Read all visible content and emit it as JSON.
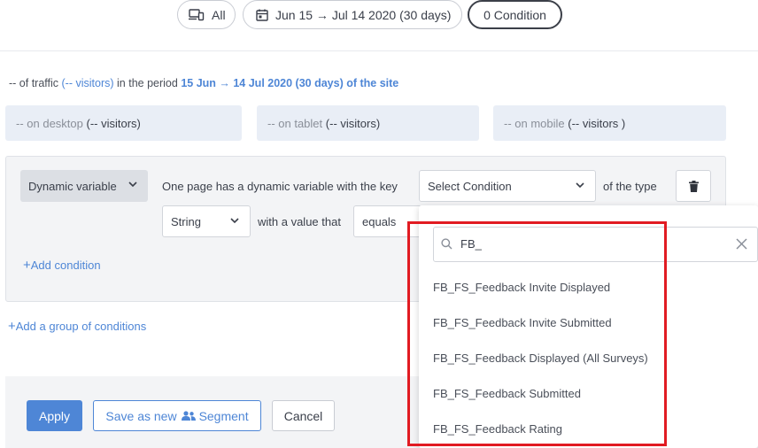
{
  "filters": {
    "device_label": "All",
    "date_range": "Jun 15 → Jul 14 2020 (30 days)",
    "condition_count": "0 Condition"
  },
  "traffic": {
    "prefix": "-- of traffic",
    "visitors": "(-- visitors)",
    "middle": "in the period",
    "period": "15 Jun → 14 Jul 2020 (30 days) of the site"
  },
  "devices": {
    "desktop_label": "-- on desktop",
    "desktop_visitors": "(-- visitors)",
    "tablet_label": "-- on tablet",
    "tablet_visitors": "(-- visitors)",
    "mobile_label": "-- on mobile",
    "mobile_visitors": "(-- visitors )"
  },
  "condition": {
    "type_label": "Dynamic variable",
    "sentence_part1": "One page has a dynamic variable with the key",
    "key_select": "Select Condition",
    "sentence_part2": "of the type",
    "value_type": "String",
    "sentence_part3": "with a value that",
    "operator": "equals",
    "add_condition": "Add condition",
    "add_group": "Add a group of conditions"
  },
  "dropdown": {
    "search_value": "FB_",
    "options": [
      "FB_FS_Feedback Invite Displayed",
      "FB_FS_Feedback Invite Submitted",
      "FB_FS_Feedback Displayed (All Surveys)",
      "FB_FS_Feedback Submitted",
      "FB_FS_Feedback Rating"
    ]
  },
  "actions": {
    "apply": "Apply",
    "save_as_new": "Save as new",
    "segment": "Segment",
    "cancel": "Cancel"
  },
  "colors": {
    "accent": "#4e86d6",
    "highlight": "#e11b22"
  }
}
